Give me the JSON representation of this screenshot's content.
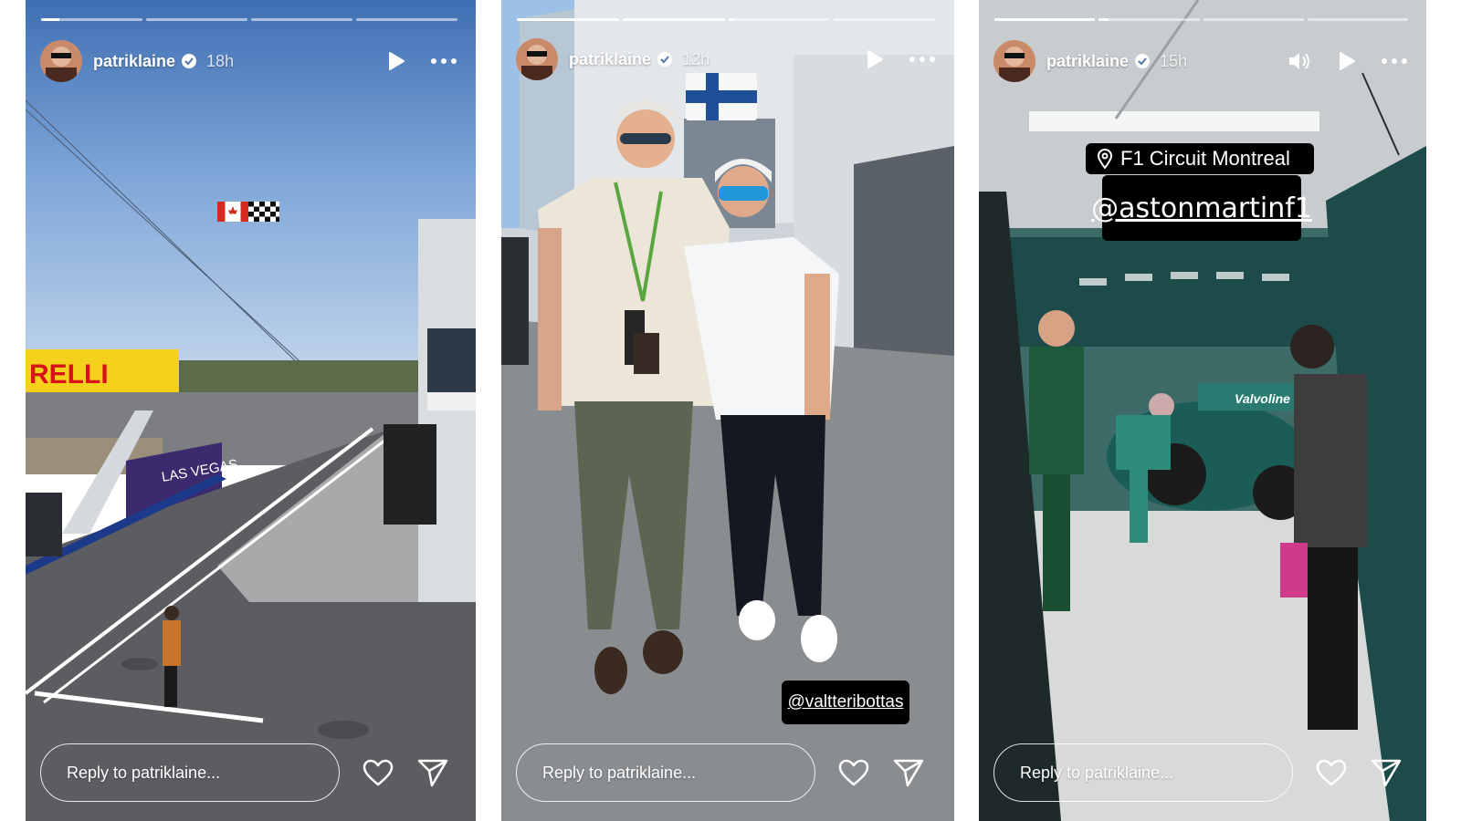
{
  "stories": [
    {
      "username": "patriklaine",
      "time": "18h",
      "progress": [
        0.18,
        0,
        0,
        0
      ],
      "reply_placeholder": "Reply to patriklaine...",
      "scene": {
        "banner_left": "RELLI",
        "banner_right": "LAS VEGAS"
      }
    },
    {
      "username": "patriklaine",
      "time": "12h",
      "progress": [
        1,
        1,
        0.06,
        0
      ],
      "reply_placeholder": "Reply to patriklaine...",
      "mention": "@valtteribottas"
    },
    {
      "username": "patriklaine",
      "time": "15h",
      "progress": [
        1,
        0.1,
        0,
        0
      ],
      "reply_placeholder": "Reply to patriklaine...",
      "location": "F1 Circuit Montreal",
      "mention": "@astonmartinf1",
      "scene": {
        "car_logo": "Valvoline"
      }
    }
  ],
  "icons": {
    "verified": "verified-badge-icon",
    "play": "play-icon",
    "more": "more-options-icon",
    "sound": "sound-on-icon",
    "like": "heart-icon",
    "share": "send-icon",
    "location": "location-pin-icon"
  },
  "colors": {
    "overlay_text": "#ffffff",
    "sticker_bg": "#000000",
    "verified_blue": "#ffffff"
  }
}
